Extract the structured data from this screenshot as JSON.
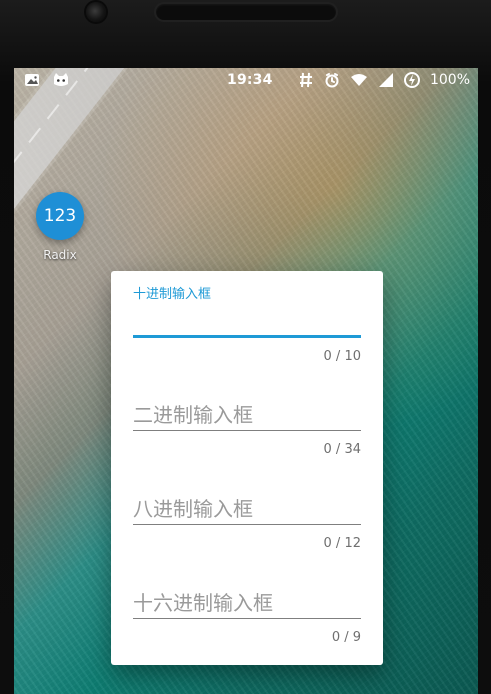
{
  "status": {
    "time": "19:34",
    "battery": "100%",
    "icons": [
      "image-icon",
      "cat-face-icon",
      "hash-icon",
      "alarm-icon",
      "wifi-icon",
      "signal-icon",
      "charging-icon"
    ]
  },
  "app": {
    "icon_text": "123",
    "label": "Radix"
  },
  "dialog": {
    "fields": [
      {
        "label": "十进制输入框",
        "placeholder": "",
        "counter": "0 / 10"
      },
      {
        "label": "",
        "placeholder": "二进制输入框",
        "counter": "0 / 34"
      },
      {
        "label": "",
        "placeholder": "八进制输入框",
        "counter": "0 / 12"
      },
      {
        "label": "",
        "placeholder": "十六进制输入框",
        "counter": "0 / 9"
      }
    ]
  },
  "colors": {
    "accent": "#1e9ad6",
    "dialog_bg": "#ffffff",
    "underline": "#7f7f7f",
    "text_muted": "#9a9a9a"
  }
}
